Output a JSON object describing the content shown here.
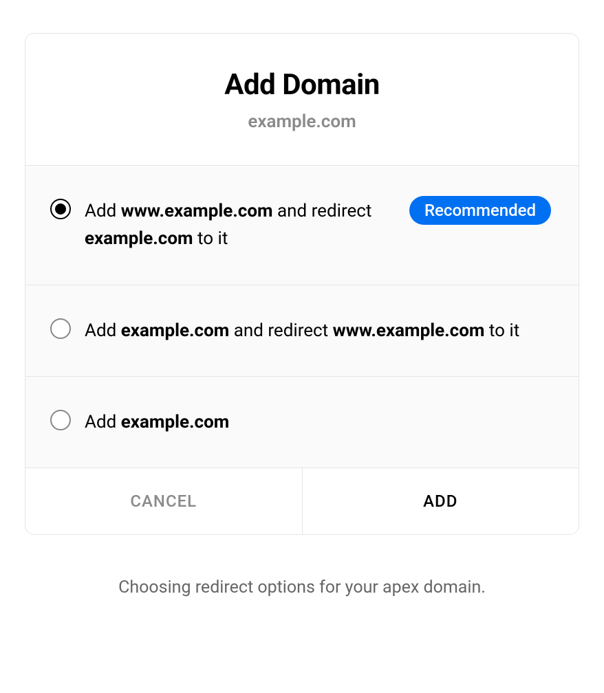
{
  "dialog": {
    "title": "Add Domain",
    "subtitle": "example.com"
  },
  "options": [
    {
      "parts": [
        "Add ",
        "www.example.com",
        " and redirect ",
        "example.com",
        " to it"
      ],
      "selected": true,
      "badge": "Recommended"
    },
    {
      "parts": [
        "Add ",
        "example.com",
        " and redirect ",
        "www.example.com",
        " to it"
      ],
      "selected": false,
      "badge": null
    },
    {
      "parts": [
        "Add ",
        "example.com",
        ""
      ],
      "selected": false,
      "badge": null
    }
  ],
  "footer": {
    "cancel": "CANCEL",
    "add": "ADD"
  },
  "caption": "Choosing redirect options for your apex domain."
}
